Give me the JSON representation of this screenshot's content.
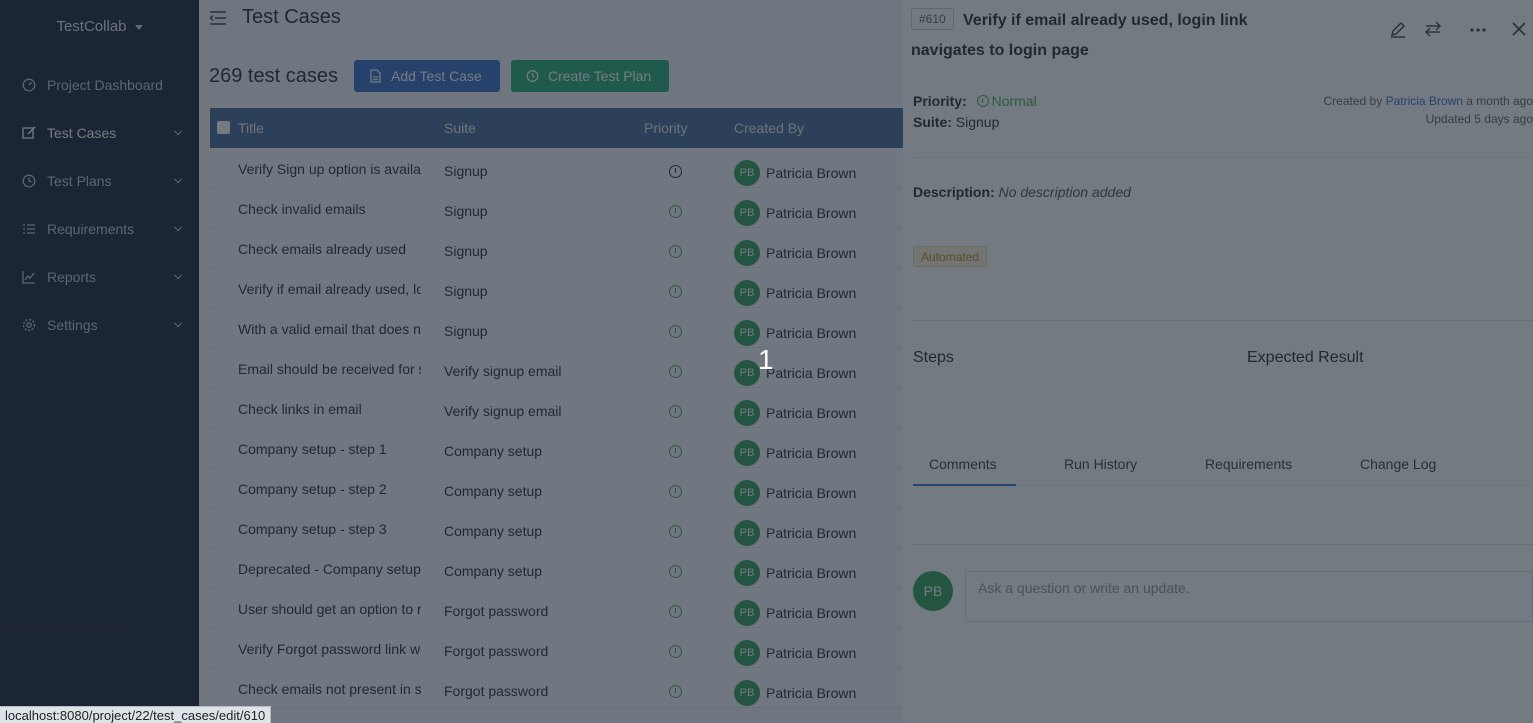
{
  "sidebar": {
    "brand": "TestCollab",
    "items": [
      {
        "label": "Project Dashboard",
        "icon": "dashboard-icon",
        "has_submenu": false
      },
      {
        "label": "Test Cases",
        "icon": "edit-icon",
        "has_submenu": true
      },
      {
        "label": "Test Plans",
        "icon": "clock-icon",
        "has_submenu": true
      },
      {
        "label": "Requirements",
        "icon": "list-icon",
        "has_submenu": true
      },
      {
        "label": "Reports",
        "icon": "chart-icon",
        "has_submenu": true
      },
      {
        "label": "Settings",
        "icon": "gear-icon",
        "has_submenu": true
      }
    ]
  },
  "main": {
    "title": "Test Cases",
    "count": "269 test cases",
    "add_button": "Add Test Case",
    "plan_button": "Create Test Plan",
    "columns": {
      "title": "Title",
      "suite": "Suite",
      "priority": "Priority",
      "created_by": "Created By"
    },
    "rows": [
      {
        "title": "Verify Sign up option is available",
        "suite": "Signup",
        "priority": "high",
        "creator": "Patricia Brown",
        "initials": "PB"
      },
      {
        "title": "Check invalid emails",
        "suite": "Signup",
        "priority": "normal",
        "creator": "Patricia Brown",
        "initials": "PB"
      },
      {
        "title": "Check emails already used",
        "suite": "Signup",
        "priority": "normal",
        "creator": "Patricia Brown",
        "initials": "PB"
      },
      {
        "title": "Verify if email already used, login link navigates to login page",
        "suite": "Signup",
        "priority": "normal",
        "creator": "Patricia Brown",
        "initials": "PB"
      },
      {
        "title": "With a valid email that does not exist",
        "suite": "Signup",
        "priority": "normal",
        "creator": "Patricia Brown",
        "initials": "PB"
      },
      {
        "title": "Email should be received for signup",
        "suite": "Verify signup email",
        "priority": "normal",
        "creator": "Patricia Brown",
        "initials": "PB"
      },
      {
        "title": "Check links in email",
        "suite": "Verify signup email",
        "priority": "normal",
        "creator": "Patricia Brown",
        "initials": "PB"
      },
      {
        "title": "Company setup - step 1",
        "suite": "Company setup",
        "priority": "normal",
        "creator": "Patricia Brown",
        "initials": "PB"
      },
      {
        "title": "Company setup - step 2",
        "suite": "Company setup",
        "priority": "normal",
        "creator": "Patricia Brown",
        "initials": "PB"
      },
      {
        "title": "Company setup - step 3",
        "suite": "Company setup",
        "priority": "normal",
        "creator": "Patricia Brown",
        "initials": "PB"
      },
      {
        "title": "Deprecated - Company setup",
        "suite": "Company setup",
        "priority": "normal",
        "creator": "Patricia Brown",
        "initials": "PB"
      },
      {
        "title": "User should get an option to reset",
        "suite": "Forgot password",
        "priority": "normal",
        "creator": "Patricia Brown",
        "initials": "PB"
      },
      {
        "title": "Verify Forgot password link works",
        "suite": "Forgot password",
        "priority": "normal",
        "creator": "Patricia Brown",
        "initials": "PB"
      },
      {
        "title": "Check emails not present in system",
        "suite": "Forgot password",
        "priority": "normal",
        "creator": "Patricia Brown",
        "initials": "PB"
      }
    ]
  },
  "detail": {
    "id": "#610",
    "title": "Verify if email already used, login link navigates to login page",
    "priority_label": "Priority:",
    "priority_value": "Normal",
    "suite_label": "Suite:",
    "suite_value": "Signup",
    "created_prefix": "Created by",
    "created_by": "Patricia Brown",
    "created_when": "a month ago",
    "updated": "Updated 5 days ago",
    "description_label": "Description:",
    "description_value": "No description added",
    "tag": "Automated",
    "steps_header": "Steps",
    "expected_header": "Expected Result",
    "tabs": [
      "Comments",
      "Run History",
      "Requirements",
      "Change Log"
    ],
    "comment_avatar": "PB",
    "comment_placeholder": "Ask a question or write an update."
  },
  "overlay": {
    "page_indicator": "1",
    "status_url": "localhost:8080/project/22/test_cases/edit/610"
  }
}
